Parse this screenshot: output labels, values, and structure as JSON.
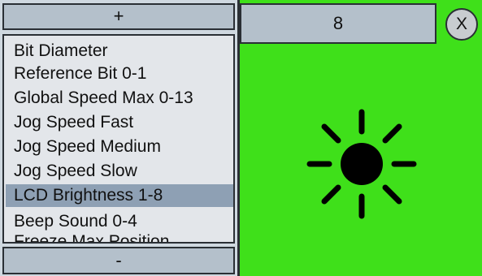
{
  "menu": {
    "up_label": "+",
    "down_label": "-",
    "items": [
      {
        "label": "Bit Diameter",
        "selected": false
      },
      {
        "label": "Reference Bit 0-1",
        "selected": false
      },
      {
        "label": "Global Speed Max 0-13",
        "selected": false
      },
      {
        "label": "Jog Speed Fast",
        "selected": false
      },
      {
        "label": "Jog Speed Medium",
        "selected": false
      },
      {
        "label": "Jog Speed Slow",
        "selected": false
      },
      {
        "label": "LCD Brightness 1-8",
        "selected": true
      },
      {
        "label": "Beep Sound 0-4",
        "selected": false
      },
      {
        "label": "Freeze Max Position",
        "selected": false
      }
    ]
  },
  "value_panel": {
    "value": "8",
    "close_label": "X",
    "icon": "sun-icon",
    "background_color": "#3fe01a"
  }
}
